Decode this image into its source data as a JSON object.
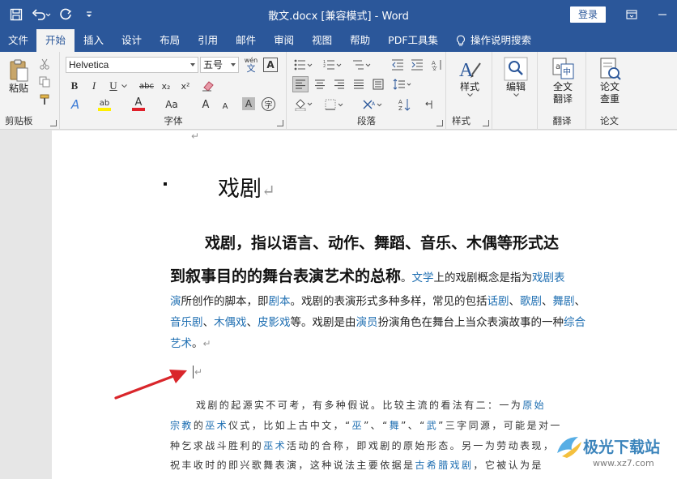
{
  "titlebar": {
    "title": "散文.docx [兼容模式]  -  Word",
    "login": "登录"
  },
  "tabs": [
    "文件",
    "开始",
    "插入",
    "设计",
    "布局",
    "引用",
    "邮件",
    "审阅",
    "视图",
    "帮助",
    "PDF工具集"
  ],
  "active_tab": "开始",
  "tell_me": "操作说明搜索",
  "ribbon": {
    "clipboard": {
      "paste": "粘贴",
      "label": "剪贴板"
    },
    "font": {
      "family": "Helvetica",
      "size": "五号",
      "wen": "wén",
      "wen_char": "文",
      "a_box": "A",
      "bold": "B",
      "italic": "I",
      "underline": "U",
      "strike": "abc",
      "sub": "x₂",
      "sup": "x²",
      "text_effect": "A",
      "highlight": "ab",
      "font_color": "A",
      "change_case": "Aa",
      "grow": "A",
      "shrink": "A",
      "char_shading": "A",
      "enclose": "字",
      "label": "字体"
    },
    "paragraph": {
      "label": "段落"
    },
    "styles": {
      "btn": "样式",
      "label": "样式"
    },
    "editing": {
      "btn": "编辑"
    },
    "translate": {
      "btn1": "全文",
      "btn2": "翻译",
      "label": "翻译"
    },
    "paper": {
      "btn1": "论文",
      "btn2": "查重",
      "label": "论文"
    }
  },
  "document": {
    "top_mark": "↵",
    "heading": "戏剧",
    "heading_mark": "↵",
    "bold_1": "戏剧，指以语言、动作、舞蹈、音乐、木偶等形式达",
    "bold_2": "到叙事目的的舞台表演艺术的总称",
    "bold_2_end": "。",
    "line2_link1": "文学",
    "line2_text1": "上的戏剧概念是指为",
    "line2_link2": "戏剧表",
    "line3_link1": "演",
    "line3_text1": "所创作的脚本，即",
    "line3_link2": "剧本",
    "line3_text2": "。戏剧的表演形式多种多样，常见的包括",
    "line3_link3": "话剧",
    "line3_sep1": "、",
    "line3_link4": "歌剧",
    "line3_sep2": "、",
    "line3_link5": "舞剧",
    "line3_sep3": "、",
    "line4_link1": "音乐剧",
    "line4_sep1": "、",
    "line4_link2": "木偶戏",
    "line4_sep2": "、",
    "line4_link3": "皮影戏",
    "line4_text1": "等。戏剧是由",
    "line4_link4": "演员",
    "line4_text2": "扮演角色在舞台上当众表演故事的一种",
    "line4_link5": "综合",
    "line5_link1": "艺术",
    "line5_text1": "。",
    "line5_mark": "↵",
    "empty_mark": "↵",
    "p2_l1_text": "戏剧的起源实不可考，有多种假说。比较主流的看法有二：一为",
    "p2_l1_link": "原始",
    "p2_l2_link1": "宗教",
    "p2_l2_text1": "的",
    "p2_l2_link2": "巫术",
    "p2_l2_text2": "仪式，比如上古中文，“",
    "p2_l2_link3": "巫",
    "p2_l2_text3": "”、“",
    "p2_l2_link4": "舞",
    "p2_l2_text4": "”、“",
    "p2_l2_link5": "武",
    "p2_l2_text5": "”三字同源，可能是对一",
    "p2_l3_text1": "种乞求战斗胜利的",
    "p2_l3_link1": "巫术",
    "p2_l3_text2": "活动的合称，即戏剧的原始形态。另一为劳动表现，",
    "p2_l4_text1": "祝丰收时的即兴歌舞表演，这种说法主要依据是",
    "p2_l4_link1": "古希腊戏剧",
    "p2_l4_text2": "，它被认为是"
  },
  "watermark": {
    "text": "极光下载站",
    "url": "www.xz7.com"
  },
  "colors": {
    "word_blue": "#2b579a",
    "link": "#1f6fb2",
    "arrow": "#d9262b"
  }
}
